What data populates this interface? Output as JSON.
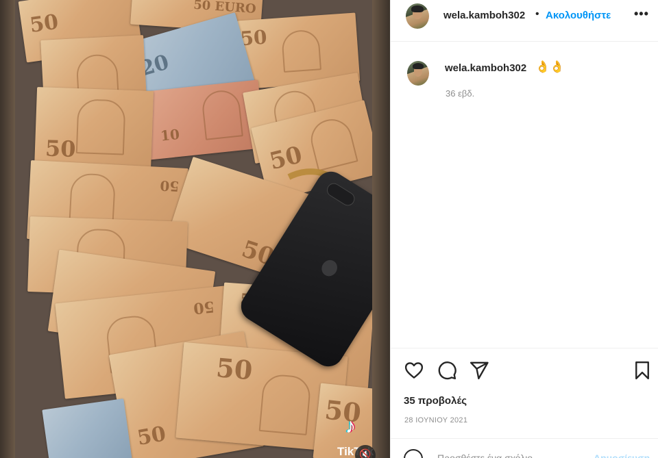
{
  "post": {
    "username": "wela.kamboh302",
    "follow_label": "Ακολουθήστε",
    "separator": "•",
    "more_label": "•••",
    "caption_emoji": "👌👌",
    "caption_time": "36 εβδ.",
    "views": "35 προβολές",
    "date": "28 ΙΟΥΝΙΟΥ 2021"
  },
  "media": {
    "watermark_logo": "♪",
    "watermark_text": "TikTok",
    "mute_icon": "speaker-muted-icon"
  },
  "comment_box": {
    "placeholder": "Προσθέστε ένα σχόλιο...",
    "post_label": "Δημοσίευση"
  },
  "icons": [
    "heart-icon",
    "comment-icon",
    "share-icon",
    "bookmark-icon",
    "emoji-icon",
    "more-icon"
  ],
  "colors": {
    "accent": "#0095f6",
    "text": "#262626",
    "muted": "#8e8e8e",
    "border": "#efefef"
  }
}
